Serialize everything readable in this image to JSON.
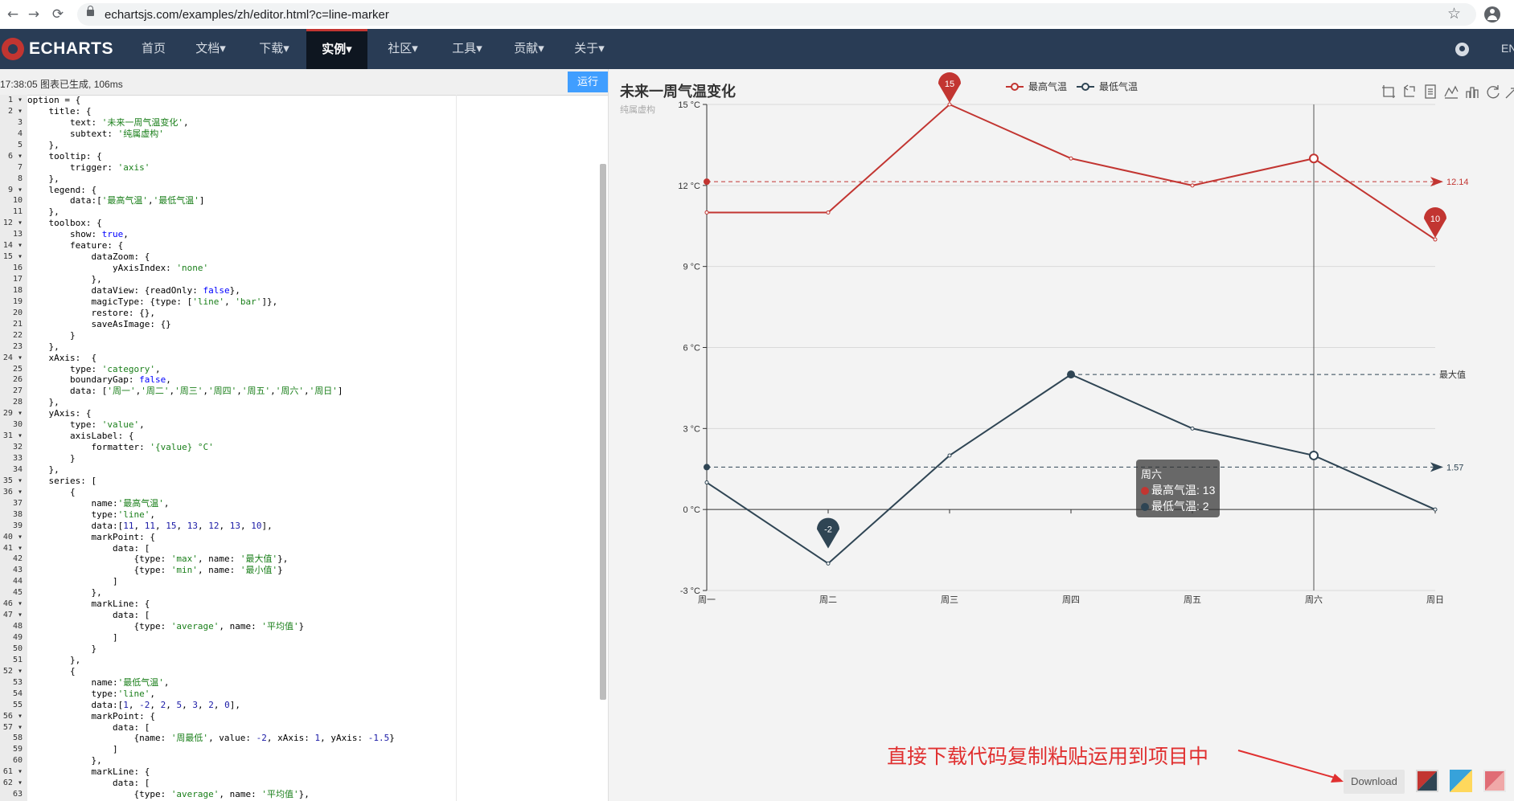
{
  "browser": {
    "url": "echartsjs.com/examples/zh/editor.html?c=line-marker",
    "back_glyph": "←",
    "forward_glyph": "→",
    "reload_glyph": "⟳",
    "bookmark_glyph": "☆"
  },
  "site_nav": {
    "logo_text": "ECHARTS",
    "items": [
      "首页",
      "文档▾",
      "下载▾",
      "实例▾",
      "社区▾",
      "工具▾",
      "贡献▾",
      "关于▾"
    ],
    "active_index": 3,
    "lang": "EN"
  },
  "editor": {
    "status_text": "17:38:05   图表已生成, 106ms",
    "run_label": "运行",
    "lines": [
      "option = {",
      "    title: {",
      "        text: '未来一周气温变化',",
      "        subtext: '纯属虚构'",
      "    },",
      "    tooltip: {",
      "        trigger: 'axis'",
      "    },",
      "    legend: {",
      "        data:['最高气温','最低气温']",
      "    },",
      "    toolbox: {",
      "        show: true,",
      "        feature: {",
      "            dataZoom: {",
      "                yAxisIndex: 'none'",
      "            },",
      "            dataView: {readOnly: false},",
      "            magicType: {type: ['line', 'bar']},",
      "            restore: {},",
      "            saveAsImage: {}",
      "        }",
      "    },",
      "    xAxis:  {",
      "        type: 'category',",
      "        boundaryGap: false,",
      "        data: ['周一','周二','周三','周四','周五','周六','周日']",
      "    },",
      "    yAxis: {",
      "        type: 'value',",
      "        axisLabel: {",
      "            formatter: '{value} °C'",
      "        }",
      "    },",
      "    series: [",
      "        {",
      "            name:'最高气温',",
      "            type:'line',",
      "            data:[11, 11, 15, 13, 12, 13, 10],",
      "            markPoint: {",
      "                data: [",
      "                    {type: 'max', name: '最大值'},",
      "                    {type: 'min', name: '最小值'}",
      "                ]",
      "            },",
      "            markLine: {",
      "                data: [",
      "                    {type: 'average', name: '平均值'}",
      "                ]",
      "            }",
      "        },",
      "        {",
      "            name:'最低气温',",
      "            type:'line',",
      "            data:[1, -2, 2, 5, 3, 2, 0],",
      "            markPoint: {",
      "                data: [",
      "                    {name: '周最低', value: -2, xAxis: 1, yAxis: -1.5}",
      "                ]",
      "            },",
      "            markLine: {",
      "                data: [",
      "                    {type: 'average', name: '平均值'},"
    ],
    "fold_lines": [
      1,
      2,
      6,
      9,
      12,
      14,
      15,
      24,
      29,
      31,
      35,
      36,
      40,
      41,
      46,
      47,
      52,
      56,
      57,
      61,
      62
    ]
  },
  "chart_data": {
    "type": "line",
    "title": "未来一周气温变化",
    "subtitle": "纯属虚构",
    "categories": [
      "周一",
      "周二",
      "周三",
      "周四",
      "周五",
      "周六",
      "周日"
    ],
    "ylim": [
      -3,
      15
    ],
    "y_ticks": [
      -3,
      0,
      3,
      6,
      9,
      12,
      15
    ],
    "y_formatter": "{value} °C",
    "grid": true,
    "legend_position": "top-center",
    "series": [
      {
        "name": "最高气温",
        "color": "#c23531",
        "values": [
          11,
          11,
          15,
          13,
          12,
          13,
          10
        ],
        "mark_points": [
          {
            "label": "15",
            "x_index": 2,
            "value": 15
          },
          {
            "label": "10",
            "x_index": 6,
            "value": 10
          }
        ],
        "mark_line": {
          "value": 12.14,
          "label": "12.14"
        }
      },
      {
        "name": "最低气温",
        "color": "#2f4554",
        "values": [
          1,
          -2,
          2,
          5,
          3,
          2,
          0
        ],
        "mark_points": [
          {
            "label": "-2",
            "x_index": 1,
            "value": -1.5
          }
        ],
        "mark_lines": [
          {
            "value": 1.57,
            "label": "1.57"
          },
          {
            "value": 5,
            "from_index": 3,
            "label": "最大值"
          }
        ]
      }
    ],
    "axis_pointer_index": 5,
    "tooltip": {
      "title": "周六",
      "rows": [
        {
          "label": "最高气温: 13",
          "color": "#c23531"
        },
        {
          "label": "最低气温: 2",
          "color": "#2f4554"
        }
      ]
    },
    "toolbox": [
      "area-zoom-icon",
      "zoom-reset-icon",
      "data-view-icon",
      "line-chart-icon",
      "bar-chart-icon",
      "restore-icon",
      "save-image-icon"
    ]
  },
  "annotation": {
    "text": "直接下载代码复制粘贴运用到项目中",
    "color": "#e03030"
  },
  "download_label": "Download",
  "theme_swatches": [
    {
      "name": "theme-red",
      "colors": [
        "#c23531",
        "#2f4554"
      ]
    },
    {
      "name": "theme-blue",
      "colors": [
        "#37a2da",
        "#ffd85c"
      ]
    },
    {
      "name": "theme-pink",
      "colors": [
        "#e06c75",
        "#d0d0d0"
      ]
    }
  ]
}
